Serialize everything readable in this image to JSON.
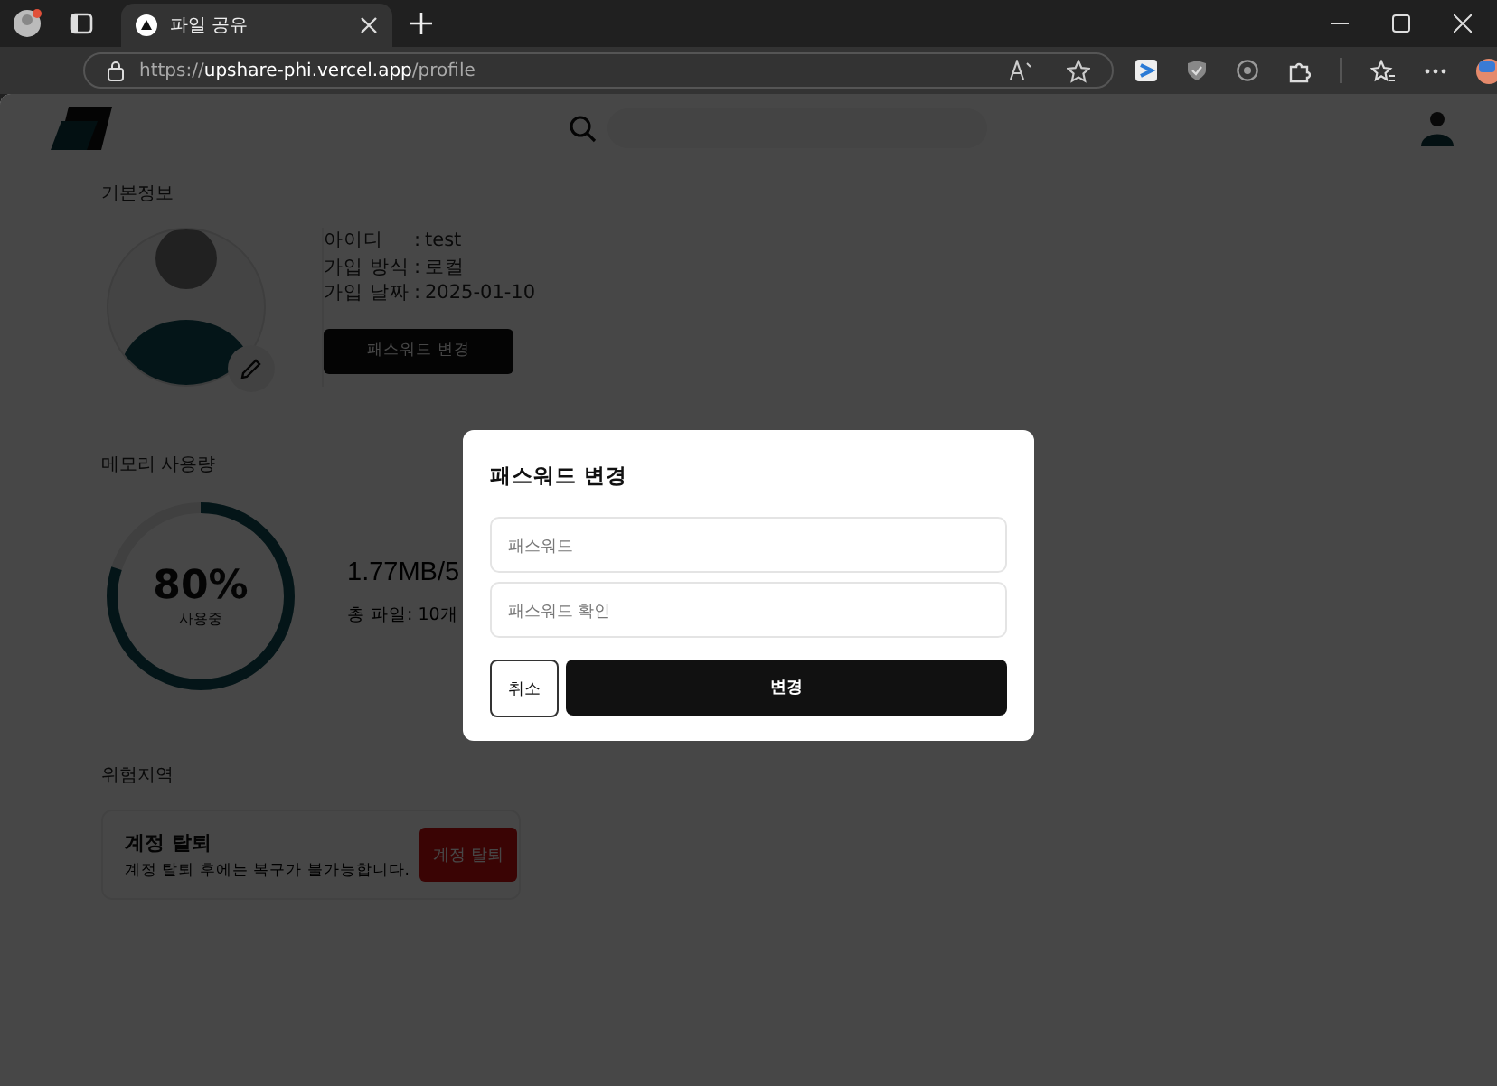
{
  "browser": {
    "tab": {
      "title": "파일 공유",
      "selected": true
    },
    "url": {
      "scheme": "https://",
      "host": "upshare-phi.vercel.app",
      "path": "/profile"
    }
  },
  "profile": {
    "heading": "기본정보",
    "fields": [
      {
        "label": "아이디",
        "separator": ":",
        "value": "test"
      },
      {
        "label": "가입 방식",
        "separator": ":",
        "value": "로컬"
      },
      {
        "label": "가입 날짜",
        "separator": ":",
        "value": "2025-01-10"
      }
    ],
    "button": "패스워드 변경"
  },
  "memory": {
    "heading": "메모리 사용량",
    "percent": "80%",
    "caption": "사용중",
    "level": 0.8,
    "usage": "1.77MB/5",
    "files": "총 파일: 10개"
  },
  "danger": {
    "heading": "위험지역",
    "title": "계정 탈퇴",
    "description": "계정 탈퇴 후에는 복구가 불가능합니다.",
    "button": "계정 탈퇴"
  },
  "modal": {
    "title": "패스워드 변경",
    "fields": [
      {
        "placeholder": "패스워드"
      },
      {
        "placeholder": "패스워드 확인"
      }
    ],
    "cancel": "취소",
    "confirm": "변경"
  }
}
